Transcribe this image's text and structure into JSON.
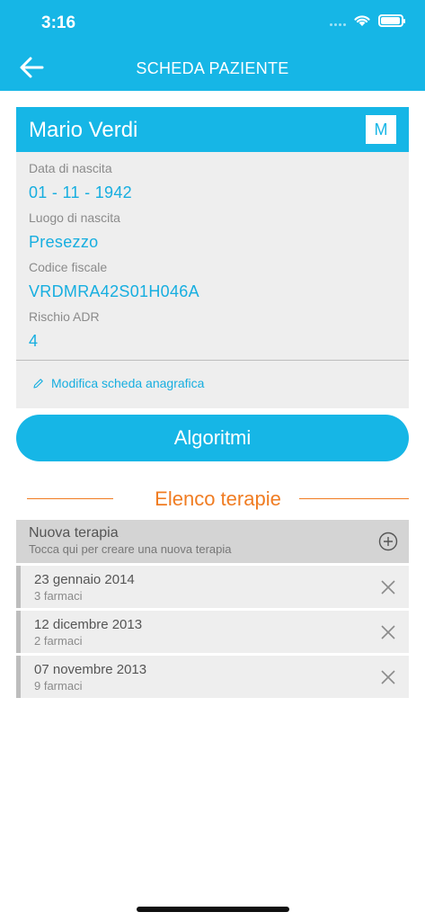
{
  "status_bar": {
    "time": "3:16"
  },
  "nav": {
    "title": "SCHEDA PAZIENTE"
  },
  "patient": {
    "name": "Mario Verdi",
    "gender_badge": "M",
    "fields": [
      {
        "label": "Data di nascita",
        "value": "01 - 11 - 1942"
      },
      {
        "label": "Luogo di nascita",
        "value": "Presezzo"
      },
      {
        "label": "Codice fiscale",
        "value": "VRDMRA42S01H046A"
      },
      {
        "label": "Rischio ADR",
        "value": "4"
      }
    ],
    "edit_label": "Modifica scheda anagrafica"
  },
  "algorithms_button": "Algoritmi",
  "therapies": {
    "section_title": "Elenco terapie",
    "new_title": "Nuova terapia",
    "new_subtitle": "Tocca qui per creare una nuova terapia",
    "items": [
      {
        "date": "23 gennaio 2014",
        "count": "3 farmaci"
      },
      {
        "date": "12 dicembre 2013",
        "count": "2 farmaci"
      },
      {
        "date": "07 novembre 2013",
        "count": "9 farmaci"
      }
    ]
  },
  "colors": {
    "primary": "#16b6e6",
    "accent": "#f07c22",
    "card_bg": "#eeeeee"
  },
  "icons": [
    "back-arrow-icon",
    "wifi-icon",
    "battery-icon",
    "pencil-icon",
    "plus-circle-icon",
    "close-icon"
  ]
}
